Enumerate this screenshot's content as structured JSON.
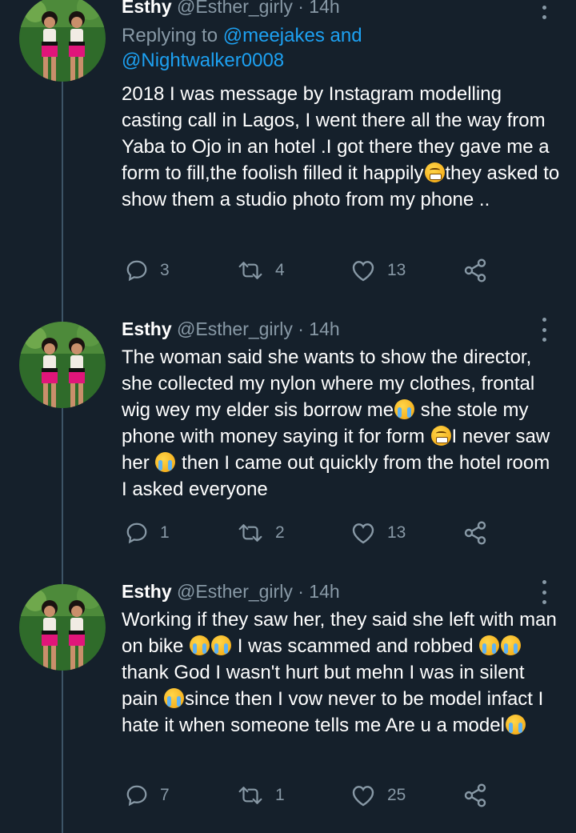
{
  "tweets": [
    {
      "name": "Esthy",
      "handle": "@Esther_girly",
      "dot": "·",
      "time": "14h",
      "replying_prefix": "Replying to",
      "replying_user1": "@meejakes",
      "replying_and": "and",
      "replying_user2": "@Nightwalker0008",
      "text_a": "2018 I was message by Instagram modelling casting call in Lagos, I went there all the way from Yaba to Ojo in an hotel .I got there they gave me a form to fill,the foolish filled it happily",
      "text_b": "they asked to show them a studio photo from my phone ..",
      "replies": "3",
      "retweets": "4",
      "likes": "13"
    },
    {
      "name": "Esthy",
      "handle": "@Esther_girly",
      "dot": "·",
      "time": "14h",
      "text_a": "The woman said she wants to show the director, she collected my nylon where my clothes, frontal wig wey my elder sis borrow me",
      "text_b": " she stole my phone with money saying it for form ",
      "text_c": "I never saw her ",
      "text_d": " then I came out quickly from the hotel room I asked everyone",
      "replies": "1",
      "retweets": "2",
      "likes": "13"
    },
    {
      "name": "Esthy",
      "handle": "@Esther_girly",
      "dot": "·",
      "time": "14h",
      "text_a": "Working if they saw her, they said she left with man on bike ",
      "text_b": " I was scammed and robbed ",
      "text_c": " thank God I wasn't hurt but mehn I was in silent pain ",
      "text_d": "since then I vow never to be model infact I hate it when someone tells me Are u a model",
      "replies": "7",
      "retweets": "1",
      "likes": "25"
    }
  ],
  "icons": {
    "reply": "reply-icon",
    "retweet": "retweet-icon",
    "like": "heart-icon",
    "share": "share-icon",
    "more": "more-icon",
    "emoji_cry": "loudly-crying-face-icon",
    "emoji_grimace": "confounded-face-icon"
  },
  "colors": {
    "background": "#15202b",
    "text": "#ffffff",
    "secondary": "#8899a6",
    "link": "#1da1f2",
    "thread_line": "#3d5466"
  }
}
